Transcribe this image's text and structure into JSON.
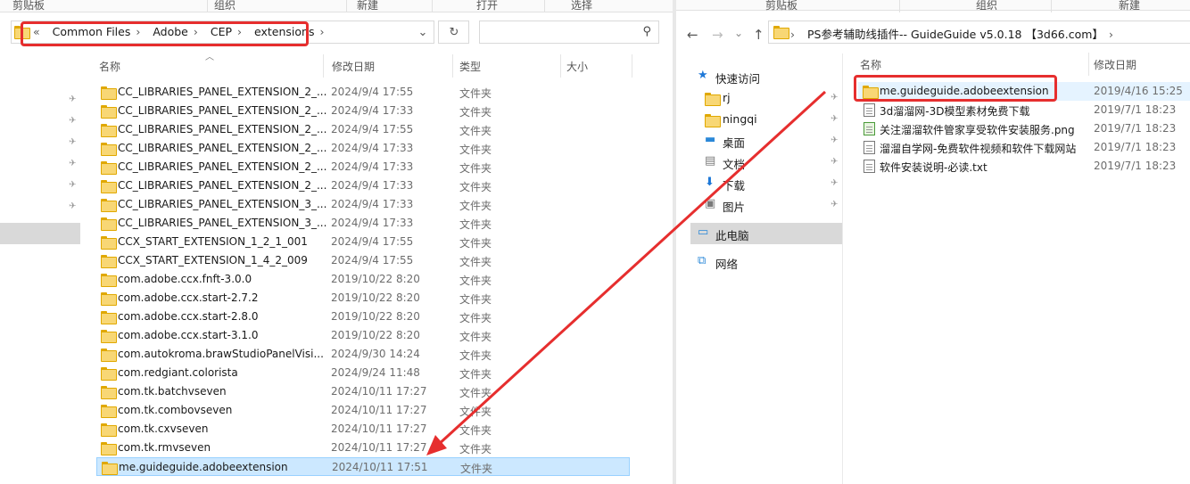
{
  "left_window": {
    "ribbon": [
      "剪贴板",
      "组织",
      "新建",
      "打开",
      "选择"
    ],
    "address": {
      "back_marker": "«",
      "crumbs": [
        "Common Files",
        "Adobe",
        "CEP",
        "extensions"
      ]
    },
    "search_placeholder": "",
    "columns": {
      "name": "名称",
      "date": "修改日期",
      "type": "类型",
      "size": "大小"
    },
    "files": [
      {
        "name": "CC_LIBRARIES_PANEL_EXTENSION_2_...",
        "date": "2024/9/4 17:55",
        "type": "文件夹"
      },
      {
        "name": "CC_LIBRARIES_PANEL_EXTENSION_2_...",
        "date": "2024/9/4 17:33",
        "type": "文件夹"
      },
      {
        "name": "CC_LIBRARIES_PANEL_EXTENSION_2_...",
        "date": "2024/9/4 17:55",
        "type": "文件夹"
      },
      {
        "name": "CC_LIBRARIES_PANEL_EXTENSION_2_...",
        "date": "2024/9/4 17:33",
        "type": "文件夹"
      },
      {
        "name": "CC_LIBRARIES_PANEL_EXTENSION_2_...",
        "date": "2024/9/4 17:33",
        "type": "文件夹"
      },
      {
        "name": "CC_LIBRARIES_PANEL_EXTENSION_2_...",
        "date": "2024/9/4 17:33",
        "type": "文件夹"
      },
      {
        "name": "CC_LIBRARIES_PANEL_EXTENSION_3_...",
        "date": "2024/9/4 17:33",
        "type": "文件夹"
      },
      {
        "name": "CC_LIBRARIES_PANEL_EXTENSION_3_...",
        "date": "2024/9/4 17:33",
        "type": "文件夹"
      },
      {
        "name": "CCX_START_EXTENSION_1_2_1_001",
        "date": "2024/9/4 17:55",
        "type": "文件夹"
      },
      {
        "name": "CCX_START_EXTENSION_1_4_2_009",
        "date": "2024/9/4 17:55",
        "type": "文件夹"
      },
      {
        "name": "com.adobe.ccx.fnft-3.0.0",
        "date": "2019/10/22 8:20",
        "type": "文件夹"
      },
      {
        "name": "com.adobe.ccx.start-2.7.2",
        "date": "2019/10/22 8:20",
        "type": "文件夹"
      },
      {
        "name": "com.adobe.ccx.start-2.8.0",
        "date": "2019/10/22 8:20",
        "type": "文件夹"
      },
      {
        "name": "com.adobe.ccx.start-3.1.0",
        "date": "2019/10/22 8:20",
        "type": "文件夹"
      },
      {
        "name": "com.autokroma.brawStudioPanelVisi...",
        "date": "2024/9/30 14:24",
        "type": "文件夹"
      },
      {
        "name": "com.redgiant.colorista",
        "date": "2024/9/24 11:48",
        "type": "文件夹"
      },
      {
        "name": "com.tk.batchvseven",
        "date": "2024/10/11 17:27",
        "type": "文件夹"
      },
      {
        "name": "com.tk.combovseven",
        "date": "2024/10/11 17:27",
        "type": "文件夹"
      },
      {
        "name": "com.tk.cxvseven",
        "date": "2024/10/11 17:27",
        "type": "文件夹"
      },
      {
        "name": "com.tk.rmvseven",
        "date": "2024/10/11 17:27",
        "type": "文件夹"
      },
      {
        "name": "me.guideguide.adobeextension",
        "date": "2024/10/11 17:51",
        "type": "文件夹",
        "selected": true
      }
    ]
  },
  "right_window": {
    "ribbon": [
      "剪贴板",
      "组织",
      "新建"
    ],
    "address": "PS参考辅助线插件-- GuideGuide v5.0.18 【3d66.com】",
    "nav": {
      "back": "←",
      "forward": "→",
      "dropdown": "⌄",
      "up": "↑"
    },
    "columns": {
      "name": "名称",
      "date": "修改日期"
    },
    "sidebar": [
      {
        "label": "快速访问",
        "icon": "star-icon"
      },
      {
        "label": "rj",
        "icon": "folder-icon",
        "pinned": true
      },
      {
        "label": "ningqi",
        "icon": "folder-icon",
        "pinned": true
      },
      {
        "label": "桌面",
        "icon": "desktop-icon",
        "pinned": true
      },
      {
        "label": "文档",
        "icon": "document-icon",
        "pinned": true
      },
      {
        "label": "下载",
        "icon": "download-icon",
        "pinned": true
      },
      {
        "label": "图片",
        "icon": "picture-icon",
        "pinned": true
      },
      {
        "label": "此电脑",
        "icon": "computer-icon"
      },
      {
        "label": "网络",
        "icon": "network-icon"
      }
    ],
    "files": [
      {
        "name": "me.guideguide.adobeextension",
        "date": "2019/4/16 15:25",
        "icon": "folder-icon",
        "selected": true
      },
      {
        "name": "3d溜溜网-3D模型素材免费下载",
        "date": "2019/7/1 18:23",
        "icon": "shortcut-icon"
      },
      {
        "name": "关注溜溜软件管家享受软件安装服务.png",
        "date": "2019/7/1 18:23",
        "icon": "png-icon"
      },
      {
        "name": "溜溜自学网-免费软件视频和软件下载网站",
        "date": "2019/7/1 18:23",
        "icon": "shortcut-icon"
      },
      {
        "name": "软件安装说明-必读.txt",
        "date": "2019/7/1 18:23",
        "icon": "text-file-icon"
      }
    ]
  },
  "annotation": {
    "color": "#e62e2e"
  }
}
